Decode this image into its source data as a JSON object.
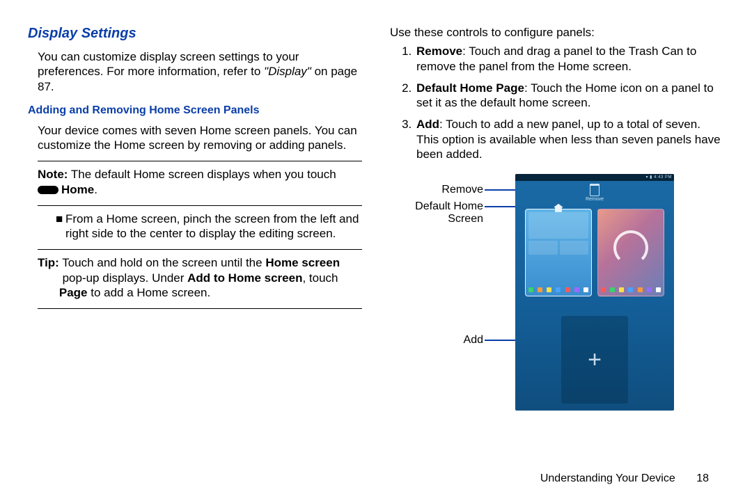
{
  "left": {
    "section_title": "Display Settings",
    "intro": "You can customize display screen settings to your preferences. For more information, refer to ",
    "intro_ref": "\"Display\"",
    "intro_tail": " on page 87.",
    "subsection_title": "Adding and Removing Home Screen Panels",
    "sub_intro": "Your device comes with seven Home screen panels. You can customize the Home screen by removing or adding panels.",
    "note_lead": "Note:",
    "note_body": " The default Home screen displays when you touch ",
    "note_home": "Home",
    "bullet": "From a Home screen, pinch the screen from the left and right side to the center to display the editing screen.",
    "tip_lead": "Tip:",
    "tip_1": " Touch and hold on the screen until the ",
    "tip_b1": "Home screen",
    "tip_2": " pop-up displays. Under ",
    "tip_b2": "Add to Home screen",
    "tip_3": ", touch ",
    "tip_b3": "Page",
    "tip_4": " to add a Home screen."
  },
  "right": {
    "intro": "Use these controls to configure panels:",
    "item1_b": "Remove",
    "item1": ": Touch and drag a panel to the Trash Can to remove the panel from the Home screen.",
    "item2_b": "Default Home Page",
    "item2": ": Touch the Home icon on a panel to set it as the default home screen.",
    "item3_b": "Add",
    "item3": ": Touch to add a new panel, up to a total of seven. This option is available when less than seven panels have been added.",
    "labels": {
      "remove": "Remove",
      "default": "Default Home Screen",
      "add": "Add"
    },
    "phone": {
      "status_time": "4:43 PM",
      "trash_label": "Remove"
    }
  },
  "footer": {
    "chapter": "Understanding Your Device",
    "page": "18"
  },
  "dock_colors_a": [
    "#3bd16f",
    "#ff9a3c",
    "#ffe14a",
    "#4aa3ff",
    "#ff5a5a",
    "#9a6bff",
    "#ffffff"
  ],
  "dock_colors_b": [
    "#ff5a5a",
    "#3bd16f",
    "#ffe14a",
    "#4aa3ff",
    "#ff9a3c",
    "#9a6bff",
    "#ffffff"
  ]
}
